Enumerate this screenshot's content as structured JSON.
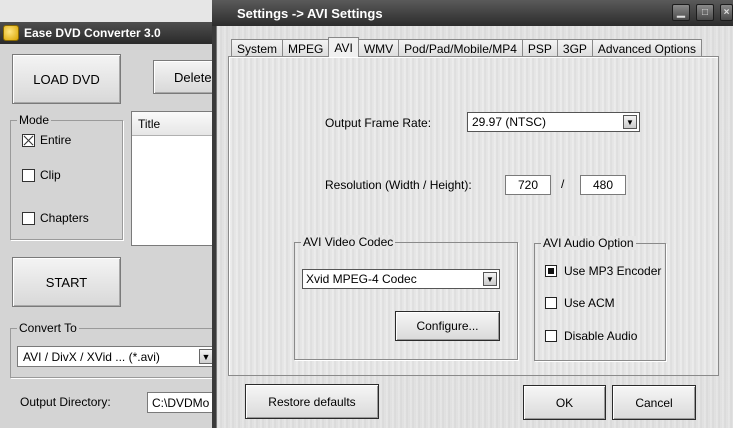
{
  "main_window": {
    "title": "Ease DVD Converter  3.0",
    "load_dvd_label": "LOAD DVD",
    "delete_label": "Delete",
    "start_label": "START",
    "mode": {
      "label": "Mode",
      "options": [
        {
          "label": "Entire",
          "checked": true
        },
        {
          "label": "Clip",
          "checked": false
        },
        {
          "label": "Chapters",
          "checked": false
        }
      ]
    },
    "title_list": {
      "header": "Title"
    },
    "convert_to": {
      "label": "Convert To",
      "selected": "AVI / DivX / XVid ... (*.avi)"
    },
    "output_directory": {
      "label": "Output Directory:",
      "value": "C:\\DVDMo"
    }
  },
  "settings_dialog": {
    "title": "Settings -> AVI Settings",
    "tabs": [
      {
        "label": "System",
        "active": false
      },
      {
        "label": "MPEG",
        "active": false
      },
      {
        "label": "AVI",
        "active": true
      },
      {
        "label": "WMV",
        "active": false
      },
      {
        "label": "Pod/Pad/Mobile/MP4",
        "active": false
      },
      {
        "label": "PSP",
        "active": false
      },
      {
        "label": "3GP",
        "active": false
      },
      {
        "label": "Advanced Options",
        "active": false
      }
    ],
    "frame_rate": {
      "label": "Output Frame Rate:",
      "value": "29.97  (NTSC)"
    },
    "resolution": {
      "label": "Resolution (Width / Height):",
      "width": "720",
      "separator": "/",
      "height": "480"
    },
    "video_codec": {
      "label": "AVI Video Codec",
      "value": "Xvid MPEG-4 Codec",
      "configure_label": "Configure..."
    },
    "audio_option": {
      "label": "AVI Audio Option",
      "options": [
        {
          "label": "Use MP3  Encoder",
          "selected": true
        },
        {
          "label": "Use ACM",
          "selected": false
        },
        {
          "label": "Disable Audio",
          "selected": false
        }
      ]
    },
    "buttons": {
      "restore_defaults": "Restore defaults",
      "ok": "OK",
      "cancel": "Cancel"
    }
  }
}
